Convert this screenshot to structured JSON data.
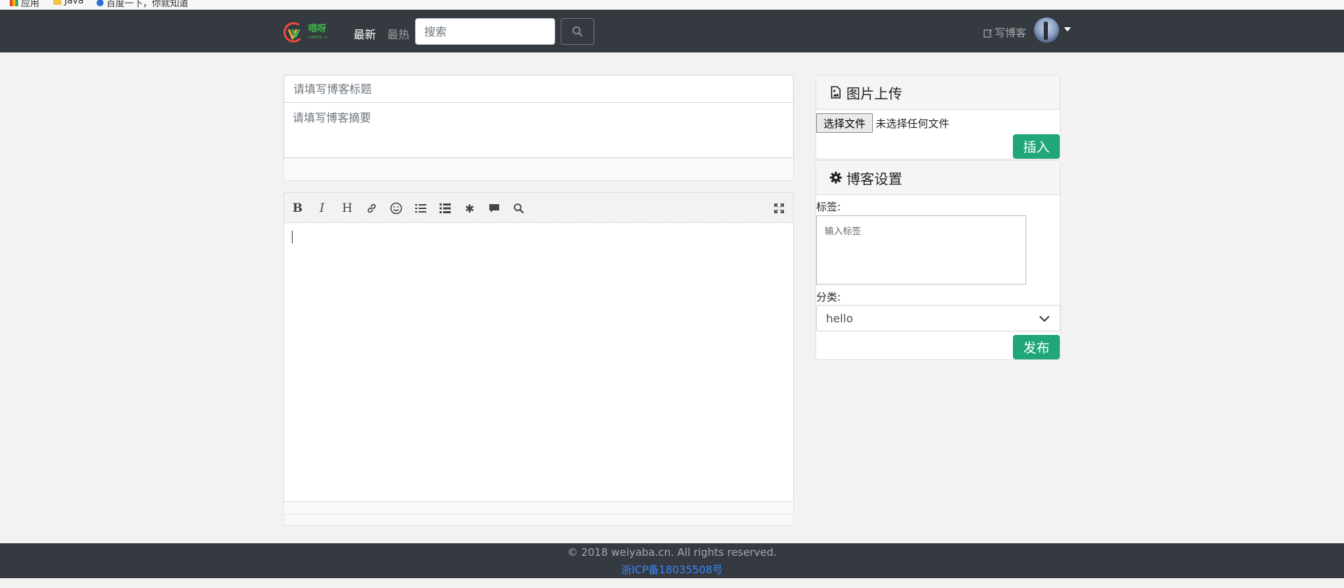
{
  "browser": {
    "bookmarks": [
      {
        "label": "应用",
        "icon": "apps-grid-icon"
      },
      {
        "label": "Java",
        "icon": "folder-icon"
      },
      {
        "label": "百度一下，你就知道",
        "icon": "baidu-icon"
      }
    ]
  },
  "navbar": {
    "logo_text": "喂呀",
    "logo_sub": "WEIYA",
    "nav_latest": "最新",
    "nav_hot": "最热",
    "search_placeholder": "搜索",
    "write_blog": "写博客"
  },
  "editor": {
    "title_placeholder": "请填写博客标题",
    "summary_placeholder": "请填写博客摘要",
    "toolbar": [
      {
        "name": "bold",
        "label": "B"
      },
      {
        "name": "italic",
        "label": "I"
      },
      {
        "name": "heading",
        "label": "H"
      },
      {
        "name": "link",
        "icon": "link-icon"
      },
      {
        "name": "emoji",
        "icon": "smile-icon"
      },
      {
        "name": "unordered-list",
        "icon": "list-ul-icon"
      },
      {
        "name": "ordered-list",
        "icon": "list-ol-icon"
      },
      {
        "name": "special",
        "icon": "asterisk-icon"
      },
      {
        "name": "comment",
        "icon": "comment-icon"
      },
      {
        "name": "search",
        "icon": "search-icon"
      },
      {
        "name": "fullscreen",
        "icon": "fullscreen-icon"
      }
    ]
  },
  "upload": {
    "header": "图片上传",
    "choose_file": "选择文件",
    "no_file": "未选择任何文件",
    "insert": "插入"
  },
  "settings": {
    "header": "博客设置",
    "tag_label": "标签:",
    "tag_placeholder": "输入标签",
    "category_label": "分类:",
    "category_value": "hello",
    "publish": "发布"
  },
  "footer": {
    "copyright": "© 2018 weiyaba.cn. All rights reserved.",
    "icp": "浙ICP备18035508号"
  },
  "colors": {
    "navbar_bg": "#343a40",
    "accent_green": "#1fa67a",
    "icp_link": "#3b86ff",
    "page_bg": "#f2f2f2"
  }
}
